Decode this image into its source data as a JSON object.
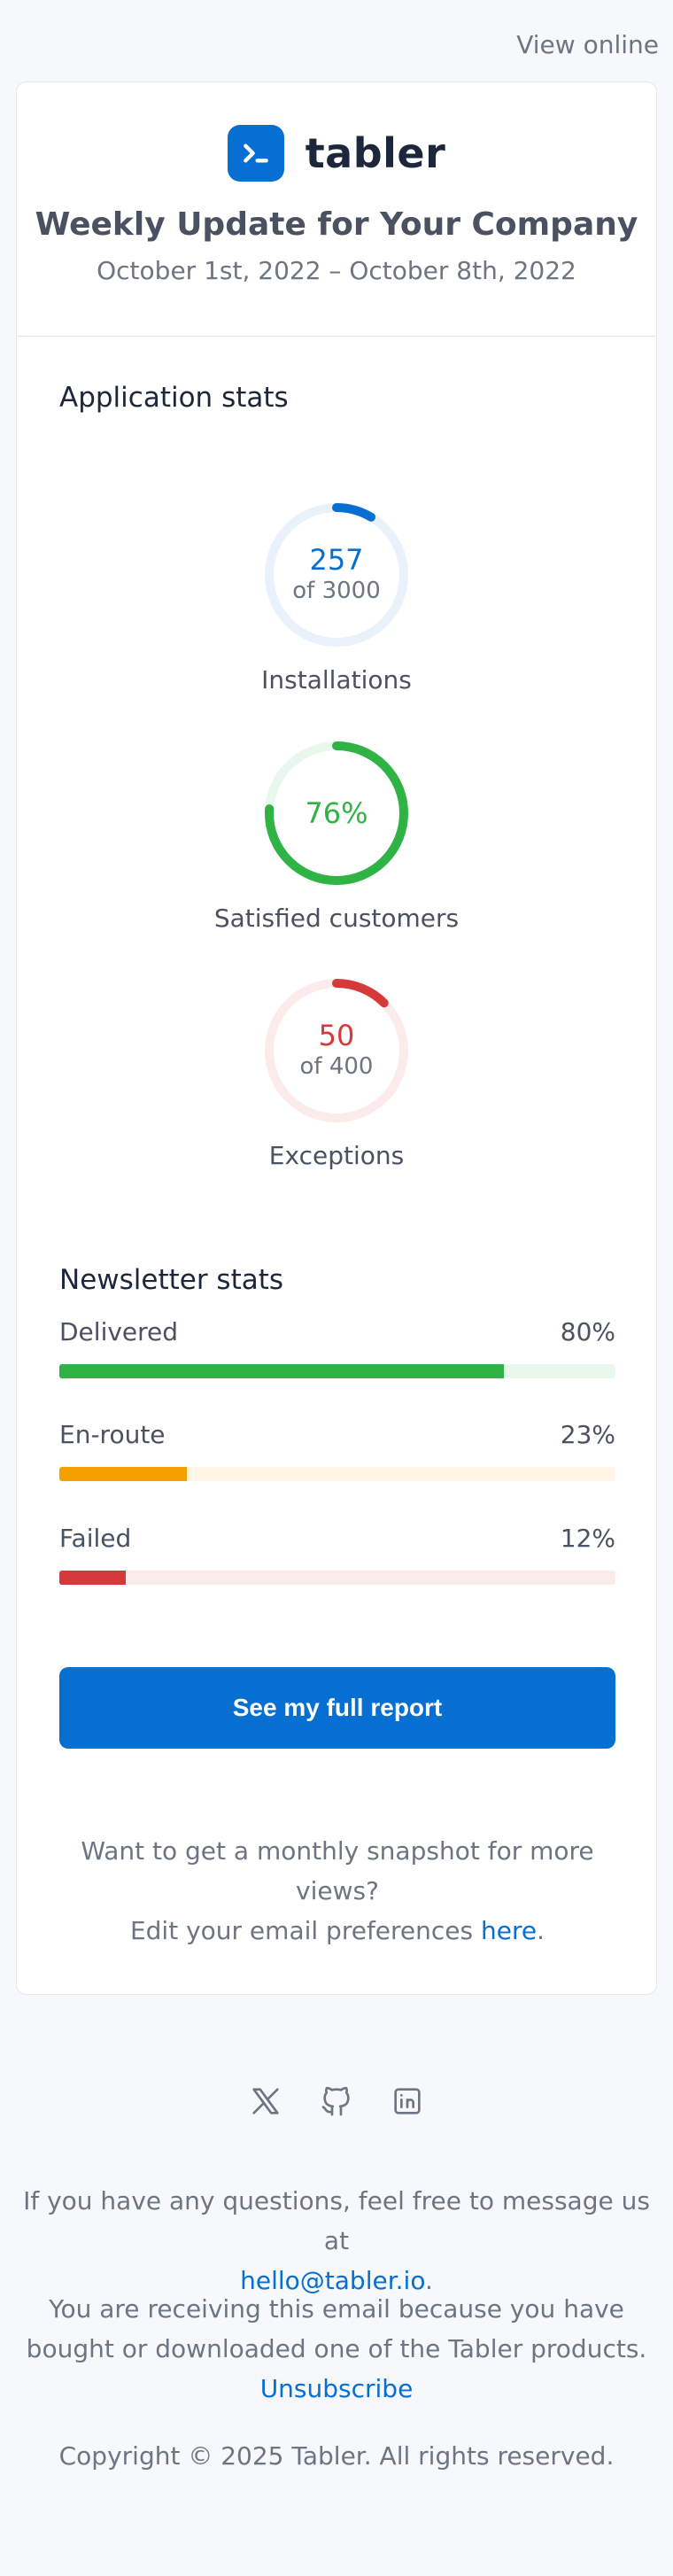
{
  "top_link": {
    "label": "View online"
  },
  "brand": {
    "name": "tabler",
    "color": "#066fd1",
    "icon": "terminal-prompt-icon"
  },
  "header": {
    "title": "Weekly Update for Your Company",
    "date_range": "October 1st, 2022 – October 8th, 2022"
  },
  "app_stats": {
    "title": "Application stats",
    "items": [
      {
        "value": "257",
        "sub": "of 3000",
        "label": "Installations",
        "fraction": 0.0857,
        "color": "#066fd1",
        "track": "#e9f1fa"
      },
      {
        "value": "76%",
        "sub": "",
        "label": "Satisfied customers",
        "fraction": 0.76,
        "color": "#2fb344",
        "track": "#eaf7ec"
      },
      {
        "value": "50",
        "sub": "of 400",
        "label": "Exceptions",
        "fraction": 0.125,
        "color": "#d63939",
        "track": "#fbebeb"
      }
    ]
  },
  "newsletter_stats": {
    "title": "Newsletter stats",
    "items": [
      {
        "label": "Delivered",
        "value": "80%",
        "fraction": 0.8,
        "color": "#2fb344",
        "track": "#eaf7ec"
      },
      {
        "label": "En-route",
        "value": "23%",
        "fraction": 0.23,
        "color": "#f59f00",
        "track": "#fef5e6"
      },
      {
        "label": "Failed",
        "value": "12%",
        "fraction": 0.12,
        "color": "#d63939",
        "track": "#fbebeb"
      }
    ]
  },
  "cta": {
    "label": "See my full report"
  },
  "note": {
    "line1": "Want to get a monthly snapshot for more views?",
    "line2_prefix": "Edit your email preferences ",
    "line2_link": "here",
    "line2_suffix": "."
  },
  "socials": [
    "x-icon",
    "github-icon",
    "linkedin-icon"
  ],
  "footer": {
    "questions_text": "If you have any questions, feel free to message us at",
    "email": "hello@tabler.io",
    "email_suffix": ".",
    "receiving_text": "You are receiving this email because you have bought or downloaded one of the Tabler products.",
    "unsubscribe": "Unsubscribe",
    "copyright": "Copyright © 2025 Tabler. All rights reserved."
  }
}
